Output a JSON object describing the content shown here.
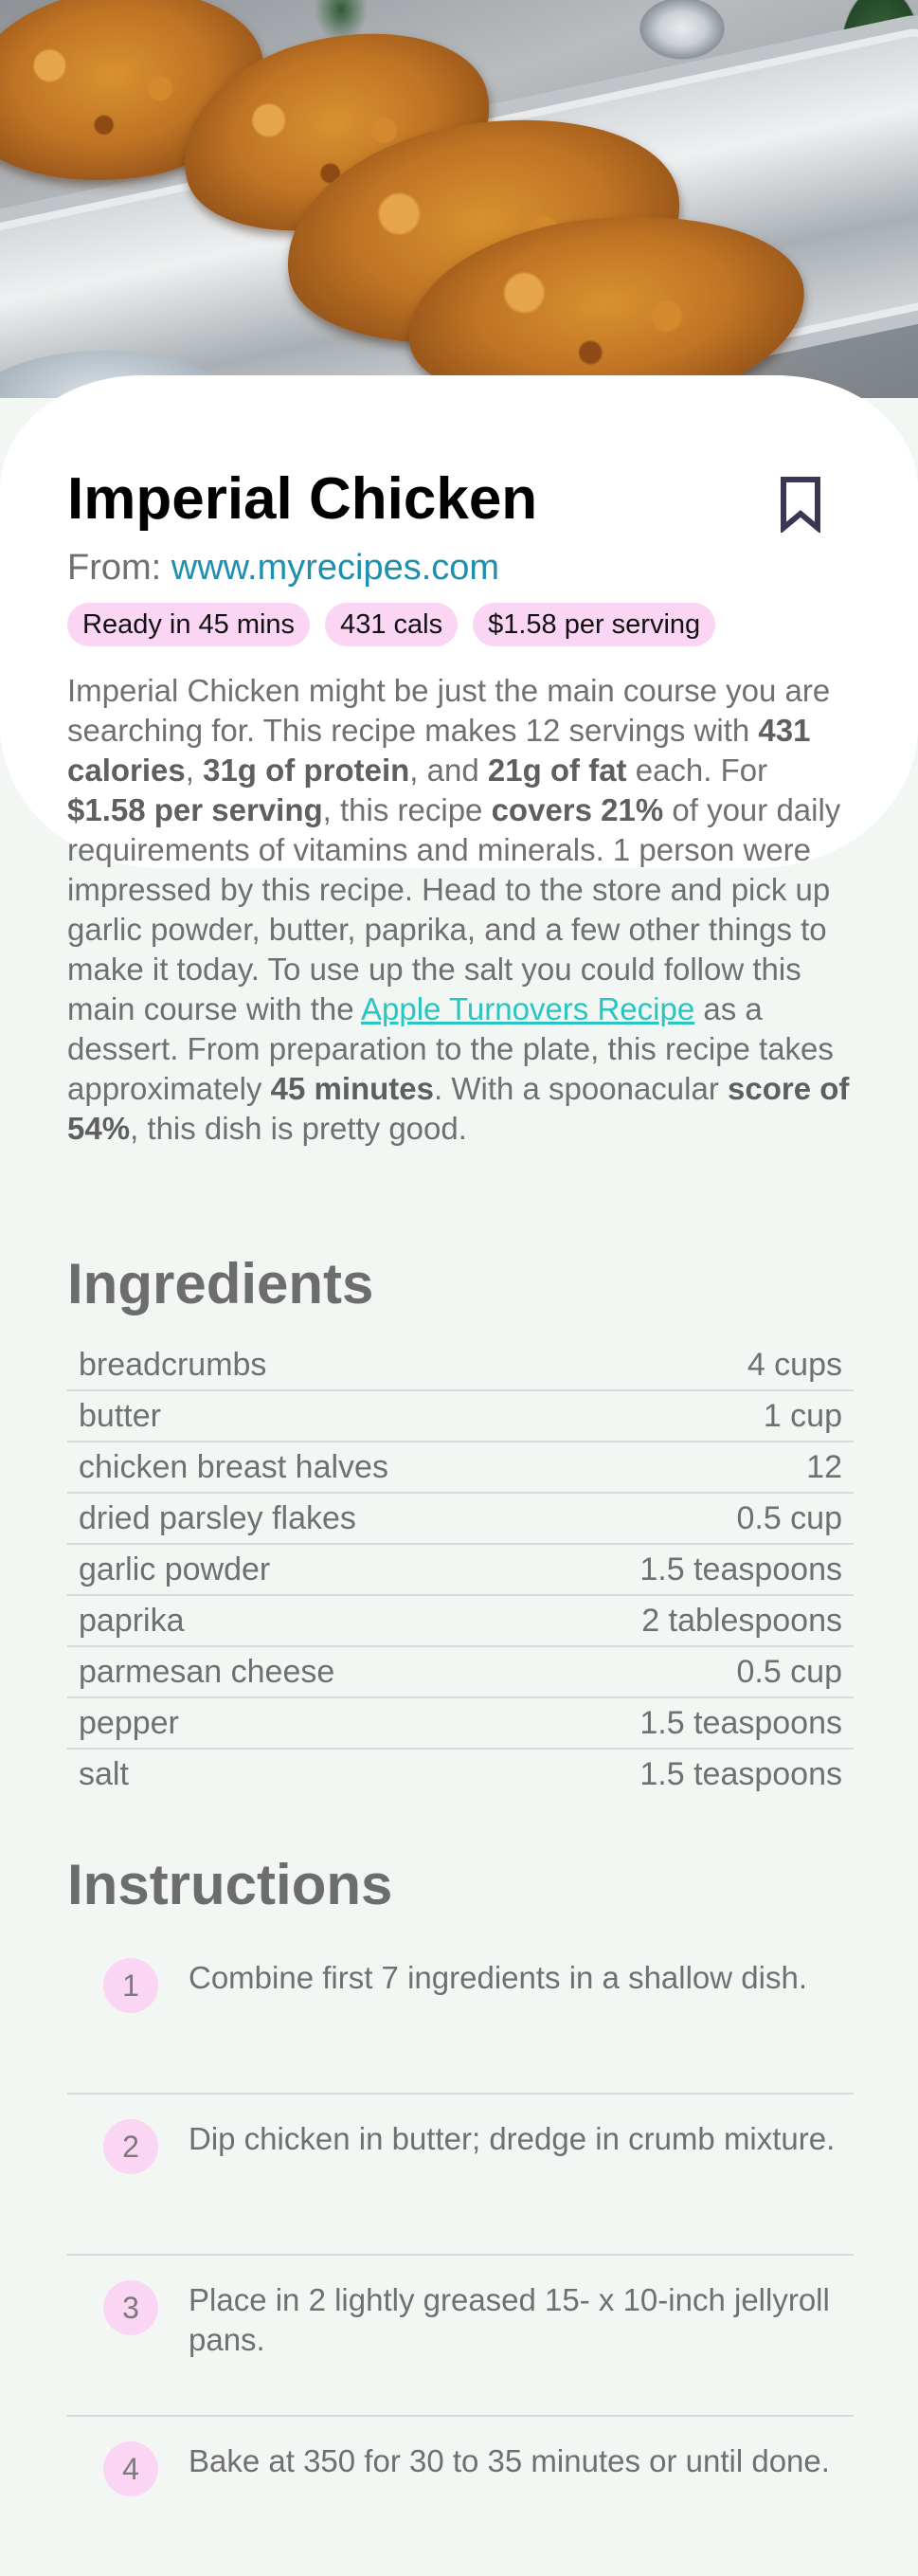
{
  "recipe": {
    "title": "Imperial Chicken",
    "from_label": "From:",
    "source": "www.myrecipes.com",
    "chips": [
      "Ready in 45 mins",
      "431 cals",
      "$1.58 per serving"
    ],
    "summary": {
      "p1": "Imperial Chicken might be just the main course you are searching for. This recipe makes 12 servings with ",
      "calories": "431 calories",
      "sep1": ", ",
      "protein": "31g of protein",
      "sep2": ", and ",
      "fat": "21g of fat",
      "p2": " each. For ",
      "price": "$1.58 per serving",
      "p3": ", this recipe ",
      "covers": "covers 21%",
      "p4": " of your daily requirements of vitamins and minerals. 1 person were impressed by this recipe. Head to the store and pick up garlic powder, butter, paprika, and a few other things to make it today. To use up the salt you could follow this main course with the ",
      "link": "Apple Turnovers Recipe",
      "p5": " as a dessert. From preparation to the plate, this recipe takes approximately ",
      "time": "45 minutes",
      "p6": ". With a spoonacular ",
      "score": "score of 54%",
      "p7": ", this dish is pretty good."
    }
  },
  "ingredients": {
    "title": "Ingredients",
    "items": [
      {
        "name": "breadcrumbs",
        "amount": "4 cups"
      },
      {
        "name": "butter",
        "amount": "1 cup"
      },
      {
        "name": "chicken breast halves",
        "amount": "12"
      },
      {
        "name": "dried parsley flakes",
        "amount": "0.5 cup"
      },
      {
        "name": "garlic powder",
        "amount": "1.5 teaspoons"
      },
      {
        "name": "paprika",
        "amount": "2 tablespoons"
      },
      {
        "name": "parmesan cheese",
        "amount": "0.5 cup"
      },
      {
        "name": "pepper",
        "amount": "1.5 teaspoons"
      },
      {
        "name": "salt",
        "amount": "1.5 teaspoons"
      }
    ]
  },
  "instructions": {
    "title": "Instructions",
    "steps": [
      {
        "number": "1",
        "text": "Combine first 7 ingredients in a shallow dish."
      },
      {
        "number": "2",
        "text": "Dip chicken in butter; dredge in crumb mixture."
      },
      {
        "number": "3",
        "text": "Place in 2 lightly greased 15- x 10-inch jellyroll pans."
      },
      {
        "number": "4",
        "text": "Bake at 350 for 30 to 35 minutes or until done."
      }
    ]
  },
  "icons": {
    "bookmark": "bookmark-outline-icon"
  },
  "colors": {
    "chip_bg": "#fbd6f4",
    "source_link": "#1e8fae",
    "recipe_link": "#27c6c2",
    "page_bg": "#f3f7f4"
  }
}
